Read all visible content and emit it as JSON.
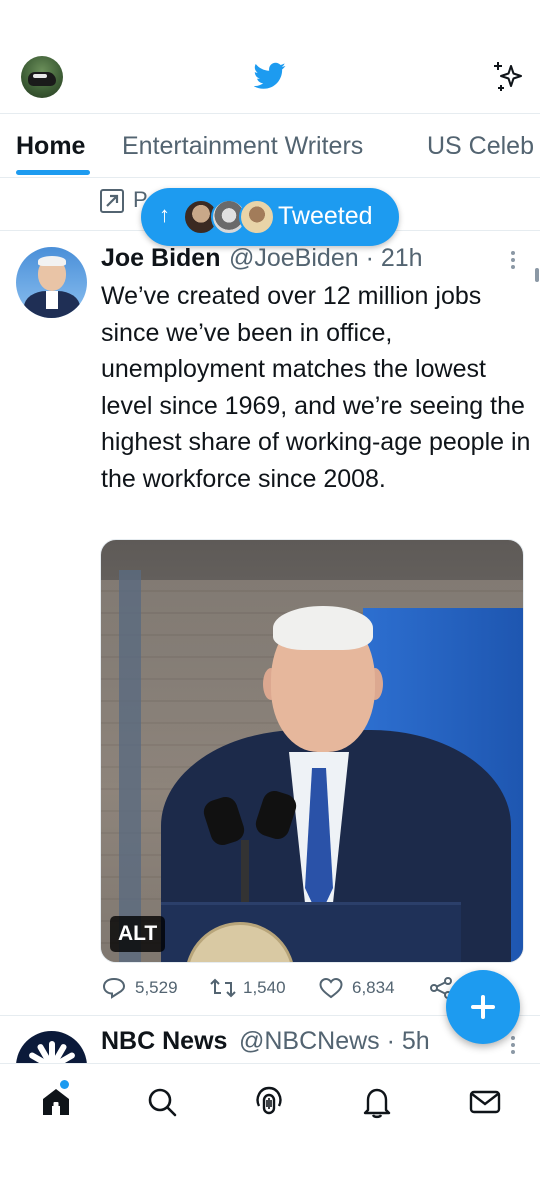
{
  "app": {
    "accent": "#1d9bf0"
  },
  "topbar": {
    "avatar": "profile-avatar",
    "logo": "twitter-bird-icon",
    "sparkle": "sparkle-icon"
  },
  "tabs": [
    {
      "label": "Home",
      "active": true
    },
    {
      "label": "Entertainment Writers",
      "active": false
    },
    {
      "label": "US Celeb",
      "active": false
    }
  ],
  "pinned": {
    "text": "P"
  },
  "new_tweets_pill": {
    "label": "Tweeted",
    "arrow": "↑"
  },
  "tweet1": {
    "name": "Joe Biden",
    "handle": "@JoeBiden · 21h",
    "text": "We’ve created over 12 million jobs since we’ve been in office, unemployment matches the lowest level since 1969, and we’re seeing the highest share of working-age people in the workforce since 2008.",
    "media_alt_badge": "ALT",
    "replies": "5,529",
    "retweets": "1,540",
    "likes": "6,834"
  },
  "tweet2": {
    "name": "NBC News",
    "handle": "@NBCNews · 5h"
  },
  "fab": {
    "icon": "plus-icon"
  },
  "bottom_nav": [
    {
      "name": "home-icon",
      "active": true
    },
    {
      "name": "search-icon"
    },
    {
      "name": "spaces-icon"
    },
    {
      "name": "notifications-icon"
    },
    {
      "name": "messages-icon"
    }
  ]
}
